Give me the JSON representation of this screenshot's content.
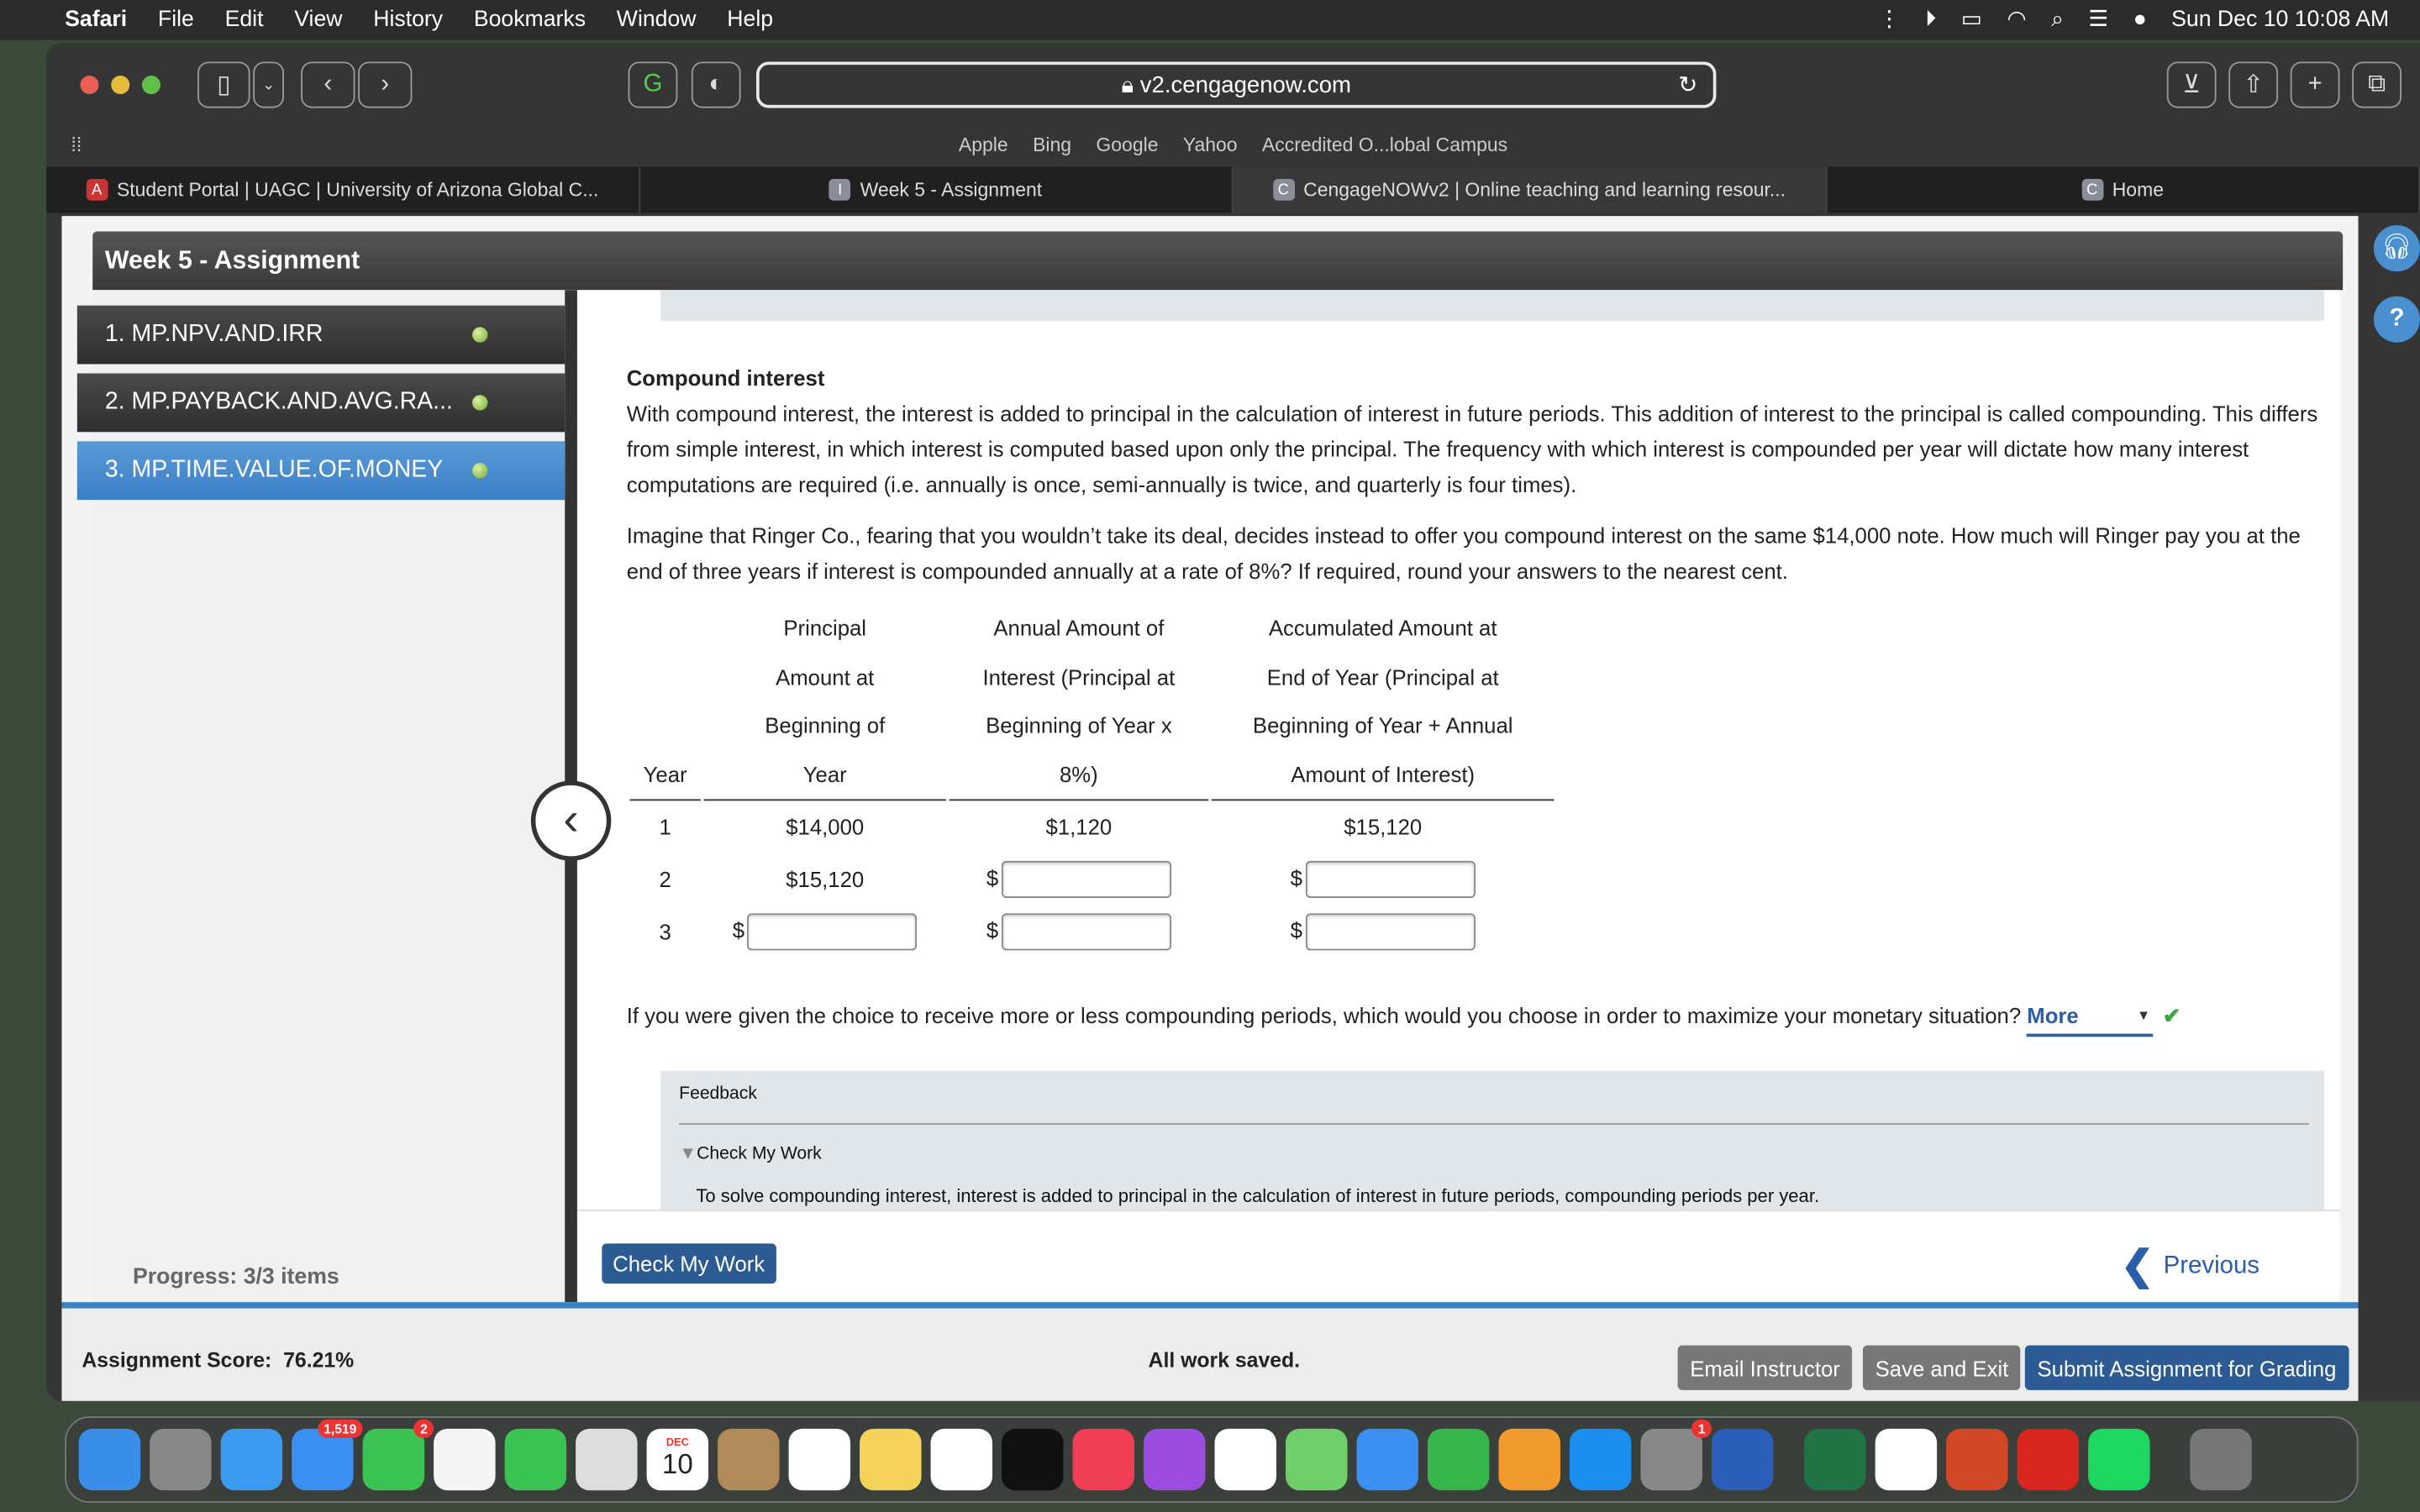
{
  "menubar": {
    "app": "Safari",
    "items": [
      "File",
      "Edit",
      "View",
      "History",
      "Bookmarks",
      "Window",
      "Help"
    ],
    "clock": "Sun Dec 10  10:08 AM"
  },
  "browser": {
    "url": "v2.cengagenow.com",
    "bookmarks": [
      "Apple",
      "Bing",
      "Google",
      "Yahoo",
      "Accredited O...lobal Campus"
    ],
    "tabs": [
      {
        "label": "Student Portal | UAGC | University of Arizona Global C...",
        "icon": "A"
      },
      {
        "label": "Week 5 - Assignment",
        "icon": "I"
      },
      {
        "label": "CengageNOWv2 | Online teaching and learning resour...",
        "icon": "C",
        "active": true
      },
      {
        "label": "Home",
        "icon": "C"
      }
    ]
  },
  "assignment": {
    "title": "Week 5 - Assignment",
    "questions": [
      {
        "label": "1. MP.NPV.AND.IRR"
      },
      {
        "label": "2. MP.PAYBACK.AND.AVG.RA..."
      },
      {
        "label": "3. MP.TIME.VALUE.OF.MONEY",
        "selected": true
      }
    ],
    "progress": "Progress:  3/3 items"
  },
  "content": {
    "heading": "Compound interest",
    "para1": "With compound interest, the interest is added to principal in the calculation of interest in future periods. This addition of interest to the principal is called compounding. This differs from simple interest, in which interest is computed based upon only the principal. The frequency with which interest is compounded per year will dictate how many interest computations are required (i.e. annually is once, semi-annually is twice, and quarterly is four times).",
    "para2": "Imagine that Ringer Co., fearing that you wouldn’t take its deal, decides instead to offer you compound interest on the same $14,000 note. How much will Ringer pay you at the end of three years if interest is compounded annually at a rate of 8%? If required, round your answers to the nearest cent.",
    "table": {
      "headers": [
        [
          "Year"
        ],
        [
          "Principal",
          "Amount at",
          "Beginning of",
          "Year"
        ],
        [
          "Annual Amount of",
          "Interest (Principal at",
          "Beginning of Year x",
          "8%)"
        ],
        [
          "Accumulated Amount at",
          "End of Year (Principal at",
          "Beginning of Year + Annual",
          "Amount of Interest)"
        ]
      ],
      "rows": [
        {
          "year": "1",
          "principal": "$14,000",
          "interest": "$1,120",
          "accumulated": "$15,120"
        },
        {
          "year": "2",
          "principal": "$15,120",
          "interest": "",
          "accumulated": ""
        },
        {
          "year": "3",
          "principal": "",
          "interest": "",
          "accumulated": ""
        }
      ],
      "currency": "$"
    },
    "question2": "If you were given the choice to receive more or less compounding periods, which would you choose in order to maximize your monetary situation?",
    "question2_answer": "More",
    "feedback": {
      "title": "Feedback",
      "toggle": "Check My Work",
      "text": "To solve compounding interest, interest is added to principal in the calculation of interest in future periods, compounding periods per year."
    }
  },
  "footer": {
    "check_my_work": "Check My Work",
    "previous": "Previous",
    "score_label": "Assignment Score:",
    "score_value": "76.21%",
    "saved": "All work saved.",
    "email": "Email Instructor",
    "save_exit": "Save and Exit",
    "submit": "Submit Assignment for Grading"
  },
  "colors": {
    "accent": "#3b7fc4",
    "button": "#2c5a93",
    "check": "#3aa83a"
  },
  "dock": {
    "apps": [
      "finder",
      "launchpad",
      "safari",
      "mail",
      "messages",
      "photos",
      "facetime",
      "roblox",
      "calendar",
      "contacts",
      "reminders",
      "notes",
      "freeform",
      "tv",
      "music",
      "podcasts",
      "news",
      "maps",
      "keynote",
      "numbers",
      "pages",
      "app-store",
      "system-settings",
      "word",
      "excel",
      "chrome",
      "powerpoint",
      "acrobat",
      "spotify",
      "trash"
    ],
    "mail_badge": "1,519",
    "messages_badge": "2",
    "settings_badge": "1",
    "calendar_month": "DEC",
    "calendar_day": "10"
  }
}
